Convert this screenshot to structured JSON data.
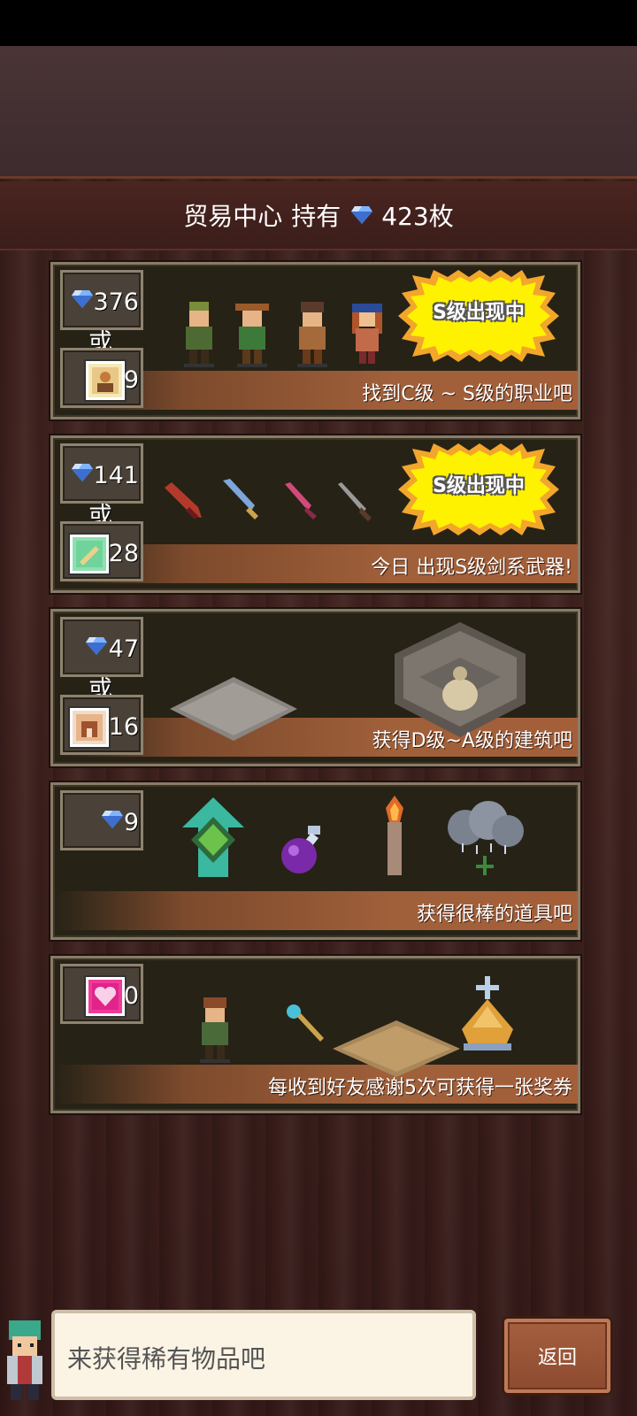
{
  "header": {
    "title": "贸易中心",
    "holding_label": "持有",
    "gem_count": "423枚"
  },
  "cards": [
    {
      "gem_price": "376",
      "or_label": "或",
      "ticket_count": "9",
      "burst_label": "S级出现中",
      "description": "找到C级 ~ S级的职业吧"
    },
    {
      "gem_price": "141",
      "or_label": "或",
      "ticket_count": "28",
      "burst_label": "S级出现中",
      "description": "今日 出现S级剑系武器!"
    },
    {
      "gem_price": "47",
      "or_label": "或",
      "ticket_count": "16",
      "description": "获得D级~A级的建筑吧"
    },
    {
      "gem_price": "9",
      "description": "获得很棒的道具吧"
    },
    {
      "ticket_count": "0",
      "description": "每收到好友感谢5次可获得一张奖券"
    }
  ],
  "dialog": {
    "message": "来获得稀有物品吧"
  },
  "buttons": {
    "back_label": "返回"
  },
  "colors": {
    "gem": "#7fb3ff",
    "burst": "#fff200",
    "burst_edge": "#f2a62c",
    "band": "#a0603a",
    "back_button": "#a55f3f"
  },
  "icons": [
    "gem-icon",
    "character-ticket-icon",
    "weapon-ticket-icon",
    "building-ticket-icon",
    "heart-ticket-icon"
  ]
}
